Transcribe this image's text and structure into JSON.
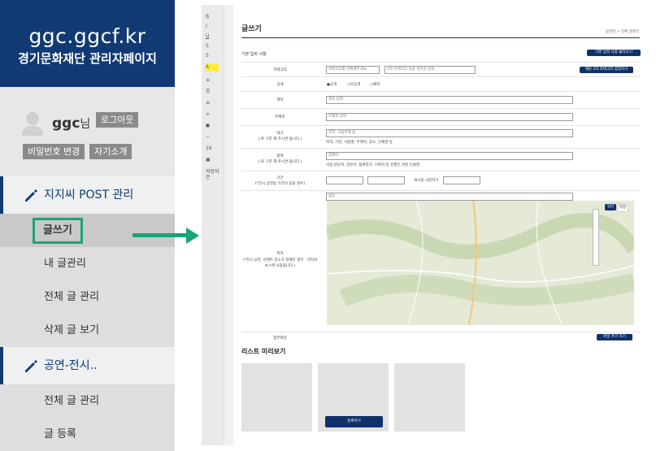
{
  "sidebar": {
    "site": "ggc.ggcf.kr",
    "site_sub": "경기문화재단 관리자페이지",
    "user": {
      "name": "ggc",
      "suffix": "님",
      "logout": "로그아웃",
      "change_pw": "비밀번호 변경",
      "profile": "자기소개"
    },
    "sections": [
      {
        "label": "지지씨 POST 관리"
      },
      {
        "label": "공연-전시.."
      }
    ],
    "items": [
      {
        "label": "글쓰기"
      },
      {
        "label": "내 글관리"
      },
      {
        "label": "전체 글 관리"
      },
      {
        "label": "삭제 글 보기"
      },
      {
        "label": "전체 글 관리"
      },
      {
        "label": "글 등록"
      }
    ]
  },
  "toolbar": {
    "buttons": [
      "B",
      "I",
      "U",
      "S",
      "S",
      "A",
      "≡",
      "☰",
      "≡",
      "∞",
      "◼",
      "−",
      "16",
      "▣",
      "저장되은"
    ]
  },
  "editor": {
    "page_title": "글쓰기",
    "breadcrumb": "글관리 > 전체 글관리",
    "section_label": "기본 입력 사항",
    "load_basic": "기본 입력 사항 불러오기",
    "add_category_btn": "해당 2차 카테고리 삽입하기",
    "fields": {
      "category": "카테고리",
      "category_select": "카테고리를 선택해주세요",
      "category_placeholder": "2차 카테고리 있을 경우만 입력",
      "visibility": "공개",
      "vis_options": [
        "●공개",
        "○비공개",
        "○예약"
      ],
      "title": "제목",
      "title_placeholder": "제목 입력",
      "subtitle": "부제목",
      "subtitle_placeholder": "부제목 입력",
      "tags": "태그",
      "tags_note": "(,로 구분 해 주시면 됩니다.)",
      "tags_placeholder": "지역, 사업주제 등",
      "tags_hint": "지역, 기관, 사업명, 주제어, 장소, 단체명 등",
      "writer": "참여",
      "writer_note": "(,로 구분 해 주시면 됩니다.)",
      "writer_placeholder": "참여자",
      "writer_hint": "사업 담당자, 글쓴이, 참여작가, 기획자 등 진행은 관련 인물명",
      "period": "기간",
      "period_note": "(*전시 공연등 기간이 있을 경우)",
      "post_date_label": "게시일 시한지기",
      "location": "위치",
      "location_note": "(*전시 공연, 이벤트 장소가 정해진 경우 - 지지씨뉴스에 사용됩니다.)",
      "location_input": "없음",
      "attachment": "첨부파일",
      "add_file": "파일 추가 하기"
    },
    "map_btns": [
      "일반",
      "위성"
    ],
    "preview_title": "리스트 미리보기",
    "register": "등록하기"
  }
}
